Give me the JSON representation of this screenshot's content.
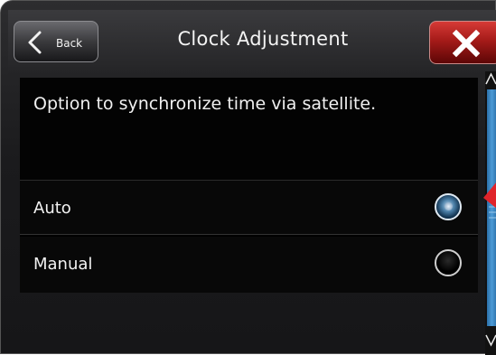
{
  "header": {
    "title": "Clock Adjustment",
    "back_label": "Back"
  },
  "content": {
    "description": "Option to synchronize time via satellite.",
    "options": [
      {
        "label": "Auto",
        "selected": true
      },
      {
        "label": "Manual",
        "selected": false
      }
    ]
  },
  "colors": {
    "close_button": "#a51b19",
    "selected_radio": "#4b7fa7",
    "scrollbar_thumb": "#4d9bd6",
    "pointer": "#e0242a"
  }
}
